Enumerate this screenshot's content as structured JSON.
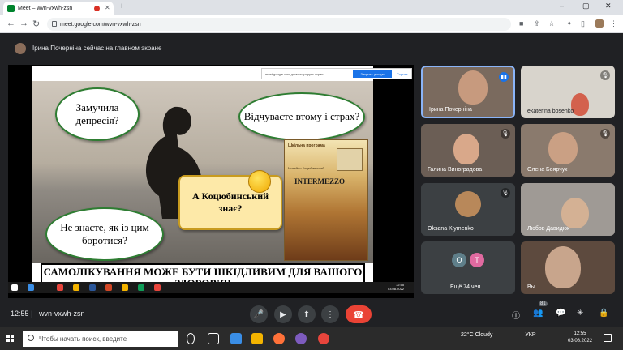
{
  "browser": {
    "tab_title": "Meet – wvn-vxwh-zsn",
    "new_tab": "+",
    "url": "meet.google.com/wvn-vxwh-zsn",
    "win_min": "–",
    "win_max": "▢",
    "win_close": "✕"
  },
  "presenting_banner": "Ірина Почерніна сейчас на главном экране",
  "slide": {
    "bubble1": "Замучила депресія?",
    "bubble2": "Відчуваєте втому і страх?",
    "bubble3": "Не знаєте, як із цим боротися?",
    "bubble4": "А Коцюбинський знає?",
    "book_series": "Шкільна програма",
    "book_author": "Михайло Коцюбинський",
    "book_title": "INTERMEZZO",
    "caption": "САМОЛІКУВАННЯ МОЖЕ БУТИ ШКІДЛИВИМ ДЛЯ ВАШОГО ЗДОРОВ'Я!",
    "notice_text": "meet.google.com демонстрирует экран",
    "notice_stop": "Закрыть доступ",
    "notice_hide": "Скрыть",
    "inner_clock_time": "12:55",
    "inner_clock_date": "03.08.2022"
  },
  "participants": [
    {
      "name": "Ірина Почерніна",
      "mic": "speaking"
    },
    {
      "name": "ekaterina bosenko",
      "mic": "muted"
    },
    {
      "name": "Галина Виноградова",
      "mic": "muted"
    },
    {
      "name": "Олена Боярчук",
      "mic": "muted"
    },
    {
      "name": "Oksana Klymenko",
      "mic": "muted"
    },
    {
      "name": "Любов Давидюк",
      "mic": "muted"
    },
    {
      "name": "Ещё 74 чел.",
      "initials": [
        "O",
        "T"
      ]
    },
    {
      "name": "Вы",
      "mic": "muted"
    }
  ],
  "bottombar": {
    "time": "12:55",
    "meeting_code": "wvn-vxwh-zsn",
    "participants_count": "81"
  },
  "taskbar": {
    "search_placeholder": "Чтобы начать поиск, введите",
    "weather": "22°C  Cloudy",
    "lang": "УКР",
    "time": "12:55",
    "date": "03.08.2022"
  },
  "colors": {
    "meet_bg": "#202124",
    "end_call": "#ea4335",
    "active_speaker": "#8ab4f8",
    "initial_o": "#5f7f8a",
    "initial_t": "#e06aa0"
  }
}
